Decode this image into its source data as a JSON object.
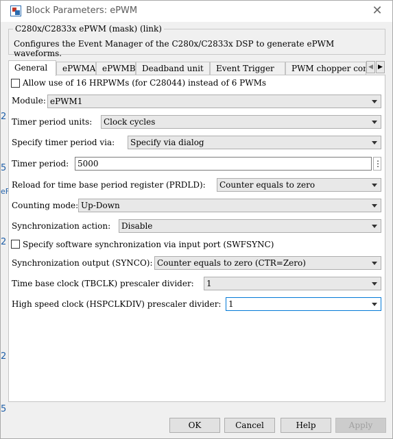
{
  "window": {
    "title": "Block Parameters: ePWM",
    "close_glyph": "✕"
  },
  "mask": {
    "legend": "C280x/C2833x ePWM (mask) (link)",
    "description": "Configures the Event Manager of the C280x/C2833x DSP to generate ePWM waveforms."
  },
  "tabs": {
    "items": [
      "General",
      "ePWMA",
      "ePWMB",
      "Deadband unit",
      "Event Trigger",
      "PWM chopper control"
    ],
    "active": "General",
    "scroll_left": "◀",
    "scroll_right": "▶"
  },
  "general": {
    "hrpwm_label": "Allow use of 16 HRPWMs (for C28044) instead of 6 PWMs",
    "hrpwm_checked": false,
    "module_label": "Module:",
    "module_value": "ePWM1",
    "timer_units_label": "Timer period units:",
    "timer_units_value": "Clock cycles",
    "specify_via_label": "Specify timer period via:",
    "specify_via_value": "Specify via dialog",
    "timer_period_label": "Timer period:",
    "timer_period_value": "5000",
    "timer_period_more": "⋮",
    "reload_label": "Reload for time base period register (PRDLD):",
    "reload_value": "Counter equals to zero",
    "counting_label": "Counting mode:",
    "counting_value": "Up-Down",
    "sync_action_label": "Synchronization action:",
    "sync_action_value": "Disable",
    "swfsync_label": "Specify software synchronization via input port (SWFSYNC)",
    "swfsync_checked": false,
    "sync_output_label": "Synchronization output (SYNCO):",
    "sync_output_value": "Counter equals to zero (CTR=Zero)",
    "tbclk_label": "Time base clock (TBCLK) prescaler divider:",
    "tbclk_value": "1",
    "hspclk_label": "High speed clock (HSPCLKDIV) prescaler divider:",
    "hspclk_value": "1"
  },
  "buttons": {
    "ok": "OK",
    "cancel": "Cancel",
    "help": "Help",
    "apply": "Apply"
  },
  "background_edge": [
    "2",
    "5",
    "eF",
    "2",
    "2",
    "5"
  ]
}
